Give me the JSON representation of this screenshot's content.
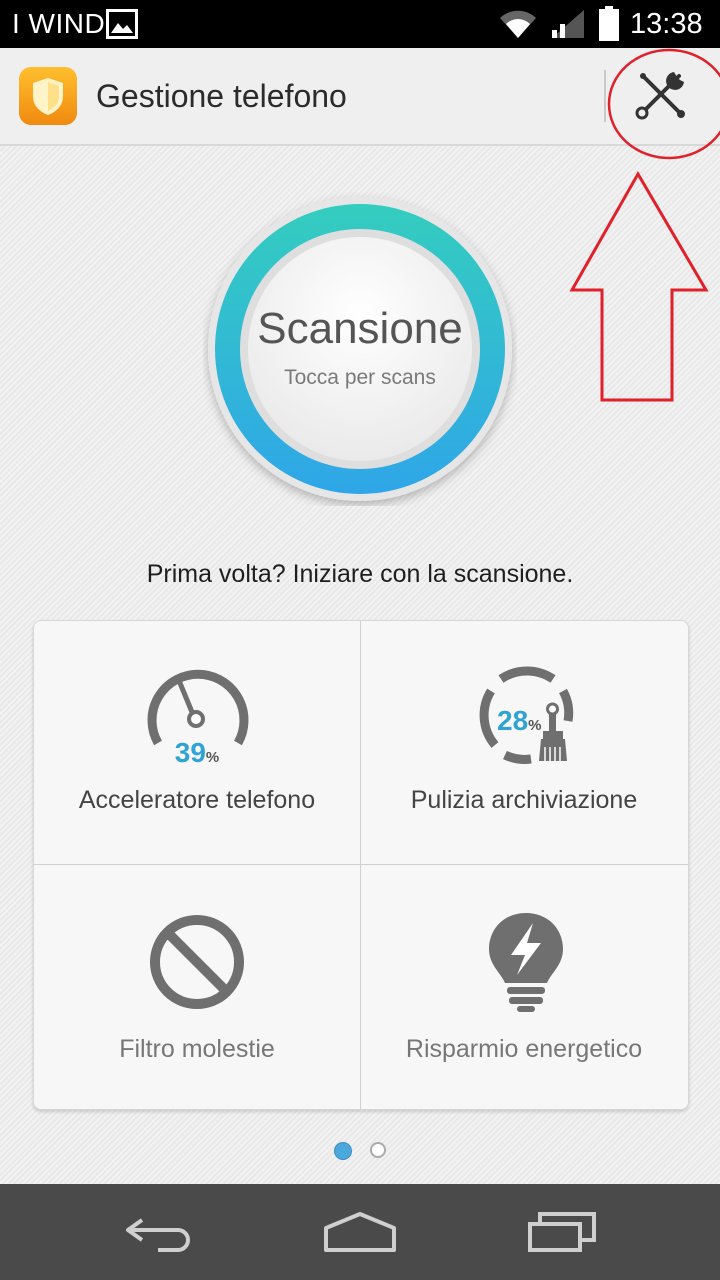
{
  "status_bar": {
    "carrier": "I WIND",
    "time": "13:38",
    "icons": [
      "image-notification-icon",
      "wifi-icon",
      "signal-icon",
      "battery-icon"
    ]
  },
  "app_bar": {
    "title": "Gestione telefono",
    "app_icon": "shield-icon",
    "action_icon": "tools-icon"
  },
  "scan": {
    "title": "Scansione",
    "subtitle": "Tocca per scans"
  },
  "hint": "Prima volta? Iniziare con la scansione.",
  "tiles": [
    {
      "label": "Acceleratore telefono",
      "icon": "speedometer-icon",
      "percent": "39",
      "percent_sign": "%"
    },
    {
      "label": "Pulizia archiviazione",
      "icon": "storage-clean-icon",
      "percent": "28",
      "percent_sign": "%"
    },
    {
      "label": "Filtro molestie",
      "icon": "block-icon"
    },
    {
      "label": "Risparmio energetico",
      "icon": "lightbulb-bolt-icon"
    }
  ],
  "pager": {
    "pages": 2,
    "active": 1
  },
  "nav": [
    "back-icon",
    "home-icon",
    "recent-apps-icon"
  ],
  "colors": {
    "accent": "#2fa3d3",
    "ring_top": "#2ec9c0",
    "ring_bottom": "#2fa9e6",
    "annotation": "#e0202a",
    "app_icon": "#f7a21b"
  }
}
